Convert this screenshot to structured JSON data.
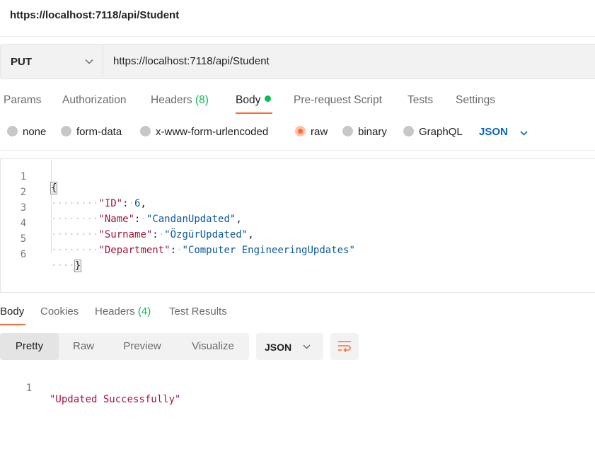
{
  "window": {
    "title": "https://localhost:7118/api/Student"
  },
  "request": {
    "method": "PUT",
    "url": "https://localhost:7118/api/Student"
  },
  "request_tabs": {
    "params": "Params",
    "authorization": "Authorization",
    "headers": "Headers",
    "headers_count": "(8)",
    "body": "Body",
    "prerequest": "Pre-request Script",
    "tests": "Tests",
    "settings": "Settings"
  },
  "body_types": {
    "none": "none",
    "form_data": "form-data",
    "urlencoded": "x-www-form-urlencoded",
    "raw": "raw",
    "binary": "binary",
    "graphql": "GraphQL",
    "selected": "raw",
    "language": "JSON"
  },
  "editor": {
    "lines": [
      {
        "n": "1",
        "open": "{"
      },
      {
        "n": "2",
        "key": "\"ID\"",
        "value": "6"
      },
      {
        "n": "3",
        "key": "\"Name\"",
        "value": "\"CandanUpdated\""
      },
      {
        "n": "4",
        "key": "\"Surname\"",
        "value": "\"ÖzgürUpdated\""
      },
      {
        "n": "5",
        "key": "\"Department\"",
        "value": "\"Computer EngineeringUpdates\""
      },
      {
        "n": "6",
        "close": "}"
      }
    ]
  },
  "response_tabs": {
    "body": "Body",
    "cookies": "Cookies",
    "headers": "Headers",
    "headers_count": "(4)",
    "test_results": "Test Results"
  },
  "response_view": {
    "pretty": "Pretty",
    "raw": "Raw",
    "preview": "Preview",
    "visualize": "Visualize",
    "format": "JSON"
  },
  "response": {
    "line_number": "1",
    "text": "\"Updated Successfully\""
  },
  "colors": {
    "accent": "#ff6c37",
    "success": "#0cbb52",
    "link": "#0265d2"
  },
  "icons": {
    "method_dropdown": "chevron-down-icon",
    "language_dropdown": "chevron-down-icon",
    "format_dropdown": "chevron-down-icon",
    "wrap": "wrap-lines-icon"
  }
}
